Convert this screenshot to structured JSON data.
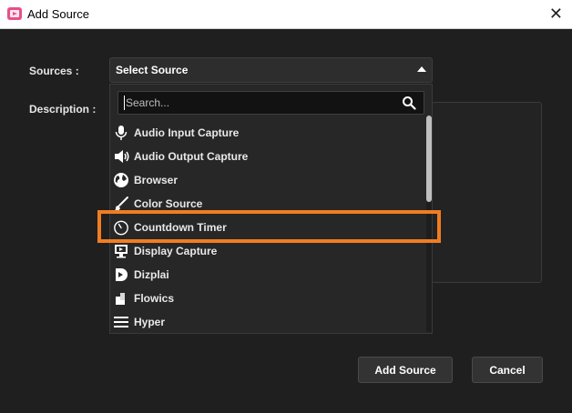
{
  "window": {
    "title": "Add Source",
    "close_symbol": "✕"
  },
  "form": {
    "sources_label": "Sources :",
    "description_label": "Description :",
    "combo_value": "Select Source"
  },
  "dropdown": {
    "search_placeholder": "Search...",
    "items": [
      {
        "label": "Audio Input Capture",
        "icon": "microphone-icon"
      },
      {
        "label": "Audio Output Capture",
        "icon": "speaker-icon"
      },
      {
        "label": "Browser",
        "icon": "globe-icon"
      },
      {
        "label": "Color Source",
        "icon": "brush-icon"
      },
      {
        "label": "Countdown Timer",
        "icon": "timer-icon",
        "highlighted": true
      },
      {
        "label": "Display Capture",
        "icon": "monitor-icon"
      },
      {
        "label": "Dizplai",
        "icon": "dizplai-icon"
      },
      {
        "label": "Flowics",
        "icon": "flowics-icon"
      },
      {
        "label": "Hyper",
        "icon": "hamburger-icon"
      }
    ]
  },
  "buttons": {
    "add_source": "Add Source",
    "cancel": "Cancel"
  },
  "colors": {
    "highlight": "#f07d22",
    "background": "#1f1f1f",
    "accent": "#e94f8a"
  }
}
